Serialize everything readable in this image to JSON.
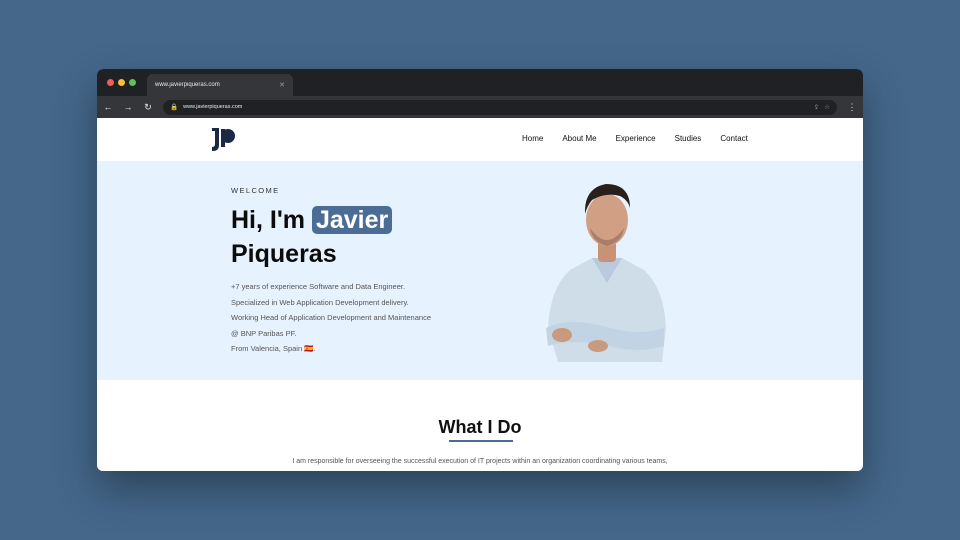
{
  "browser": {
    "tab_title": "www.javierpiqueras.com",
    "url": "www.javierpiqueras.com",
    "icons": {
      "back": "back-arrow-icon",
      "forward": "forward-arrow-icon",
      "reload": "reload-icon",
      "lock": "lock-icon",
      "share": "share-icon",
      "bookmark": "star-icon",
      "menu": "kebab-menu-icon",
      "close": "close-icon"
    }
  },
  "nav": {
    "logo": "JP logo",
    "links": [
      "Home",
      "About Me",
      "Experience",
      "Studies",
      "Contact"
    ]
  },
  "hero": {
    "welcome": "WELCOME",
    "greeting": "Hi, I'm ",
    "name": "Javier",
    "surname": "Piqueras",
    "bio": [
      "+7 years of experience Software and Data Engineer.",
      "Specialized in Web Application Development delivery.",
      "Working Head of Application Development and Maintenance",
      "@ BNP Paribas PF.",
      "From Valencia, Spain 🇪🇸."
    ]
  },
  "what_i_do": {
    "title": "What I Do",
    "text": "I am responsible for overseeing the successful execution of IT projects within an organization coordinating various teams,"
  },
  "colors": {
    "background": "#44678a",
    "accent": "#4b6c94",
    "hero_bg": "#e6f2fe",
    "logo": "#1b2a44"
  }
}
